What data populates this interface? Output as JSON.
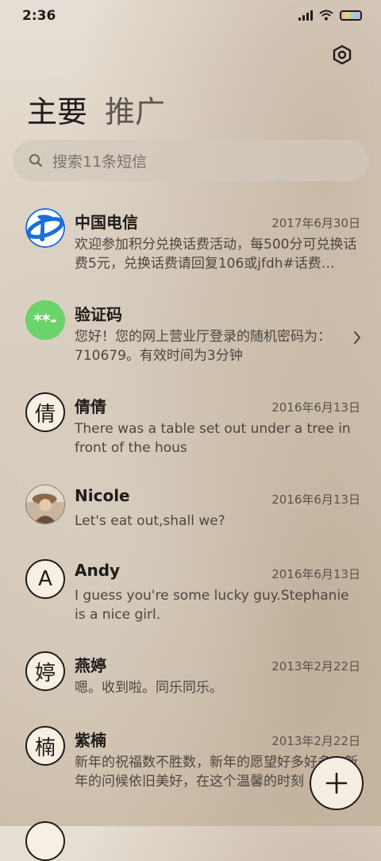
{
  "status_bar": {
    "time": "2:36"
  },
  "header": {
    "tabs": [
      {
        "label": "主要"
      },
      {
        "label": "推广"
      }
    ]
  },
  "search": {
    "placeholder": "搜索11条短信"
  },
  "conversations": [
    {
      "name": "中国电信",
      "date": "2017年6月30日",
      "preview": "欢迎参加积分兑换话费活动，每500分可兑换话费5元，兑换话费请回复106或jfdh#话费…",
      "avatar_icon": "china-telecom-logo"
    },
    {
      "name": "验证码",
      "date": "",
      "preview": "您好！您的网上营业厅登录的随机密码为：710679。有效时间为3分钟",
      "avatar_text": "**-",
      "avatar_color": "#6cd26a"
    },
    {
      "name": "倩倩",
      "date": "2016年6月13日",
      "preview": "There was a table set out under a tree in front of the hous",
      "avatar_text": "倩"
    },
    {
      "name": "Nicole",
      "date": "2016年6月13日",
      "preview": "Let's eat out,shall we?",
      "avatar_icon": "photo-avatar"
    },
    {
      "name": "Andy",
      "date": "2016年6月13日",
      "preview": "I guess you're some lucky guy.Stephanie is a nice girl.",
      "avatar_text": "A"
    },
    {
      "name": "燕婷",
      "date": "2013年2月22日",
      "preview": "嗯。收到啦。同乐同乐。",
      "avatar_text": "婷"
    },
    {
      "name": "紫楠",
      "date": "2013年2月22日",
      "preview": "新年的祝福数不胜数，新年的愿望好多好多，新年的问候依旧美好，在这个温馨的时刻",
      "avatar_text": "楠"
    }
  ],
  "colors": {
    "accent_green": "#6cd26a",
    "telecom_blue": "#1a6fd8"
  }
}
